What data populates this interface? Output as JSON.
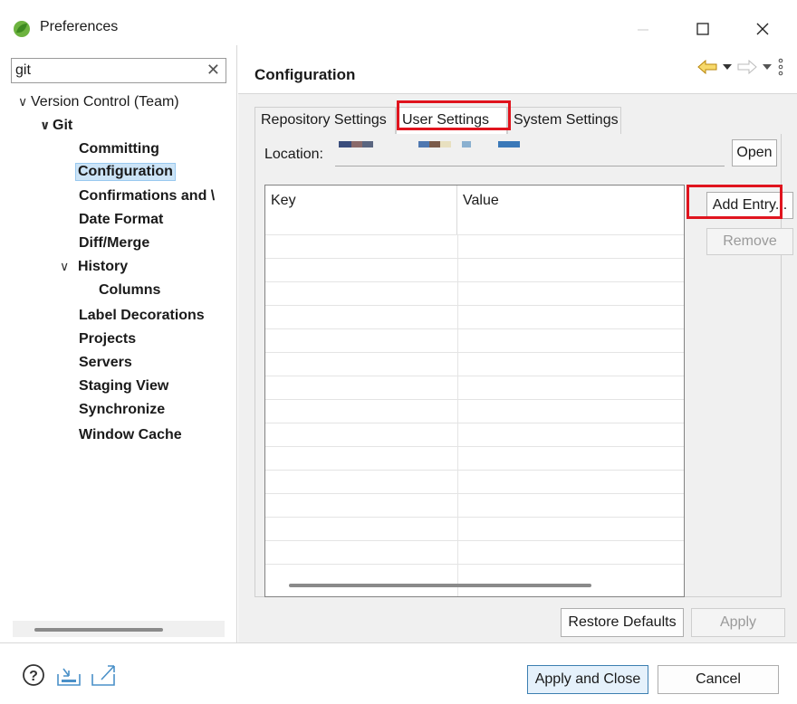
{
  "window": {
    "title": "Preferences"
  },
  "filter": {
    "value": "git",
    "clear_glyph": "✕"
  },
  "tree": {
    "items": [
      {
        "label": "Version Control (Team)",
        "level": 0,
        "expanded": true
      },
      {
        "label": "Git",
        "level": 1,
        "expanded": true
      },
      {
        "label": "Committing",
        "level": 2
      },
      {
        "label": "Configuration",
        "level": 2,
        "selected": true
      },
      {
        "label": "Confirmations and \\",
        "level": 2
      },
      {
        "label": "Date Format",
        "level": 2
      },
      {
        "label": "Diff/Merge",
        "level": 2
      },
      {
        "label": "History",
        "level": 2,
        "expanded": true
      },
      {
        "label": "Columns",
        "level": 3
      },
      {
        "label": "Label Decorations",
        "level": 2
      },
      {
        "label": "Projects",
        "level": 2
      },
      {
        "label": "Servers",
        "level": 2
      },
      {
        "label": "Staging View",
        "level": 2
      },
      {
        "label": "Synchronize",
        "level": 2
      },
      {
        "label": "Window Cache",
        "level": 2
      }
    ]
  },
  "page": {
    "title": "Configuration"
  },
  "tabs": [
    {
      "label": "Repository Settings"
    },
    {
      "label": "User Settings",
      "active": true
    },
    {
      "label": "System Settings"
    }
  ],
  "location": {
    "label": "Location:",
    "open_label": "Open"
  },
  "table": {
    "columns": [
      "Key",
      "Value"
    ],
    "rows": []
  },
  "side_buttons": {
    "add_entry": "Add Entry...",
    "remove": "Remove"
  },
  "page_buttons": {
    "restore_defaults": "Restore Defaults",
    "apply": "Apply"
  },
  "dialog_buttons": {
    "apply_and_close": "Apply and Close",
    "cancel": "Cancel"
  },
  "colors": {
    "highlight": "#e0141e",
    "selection": "#cce4f7",
    "default_button_border": "#3c7fb1",
    "app_icon_green": "#6db33f"
  }
}
